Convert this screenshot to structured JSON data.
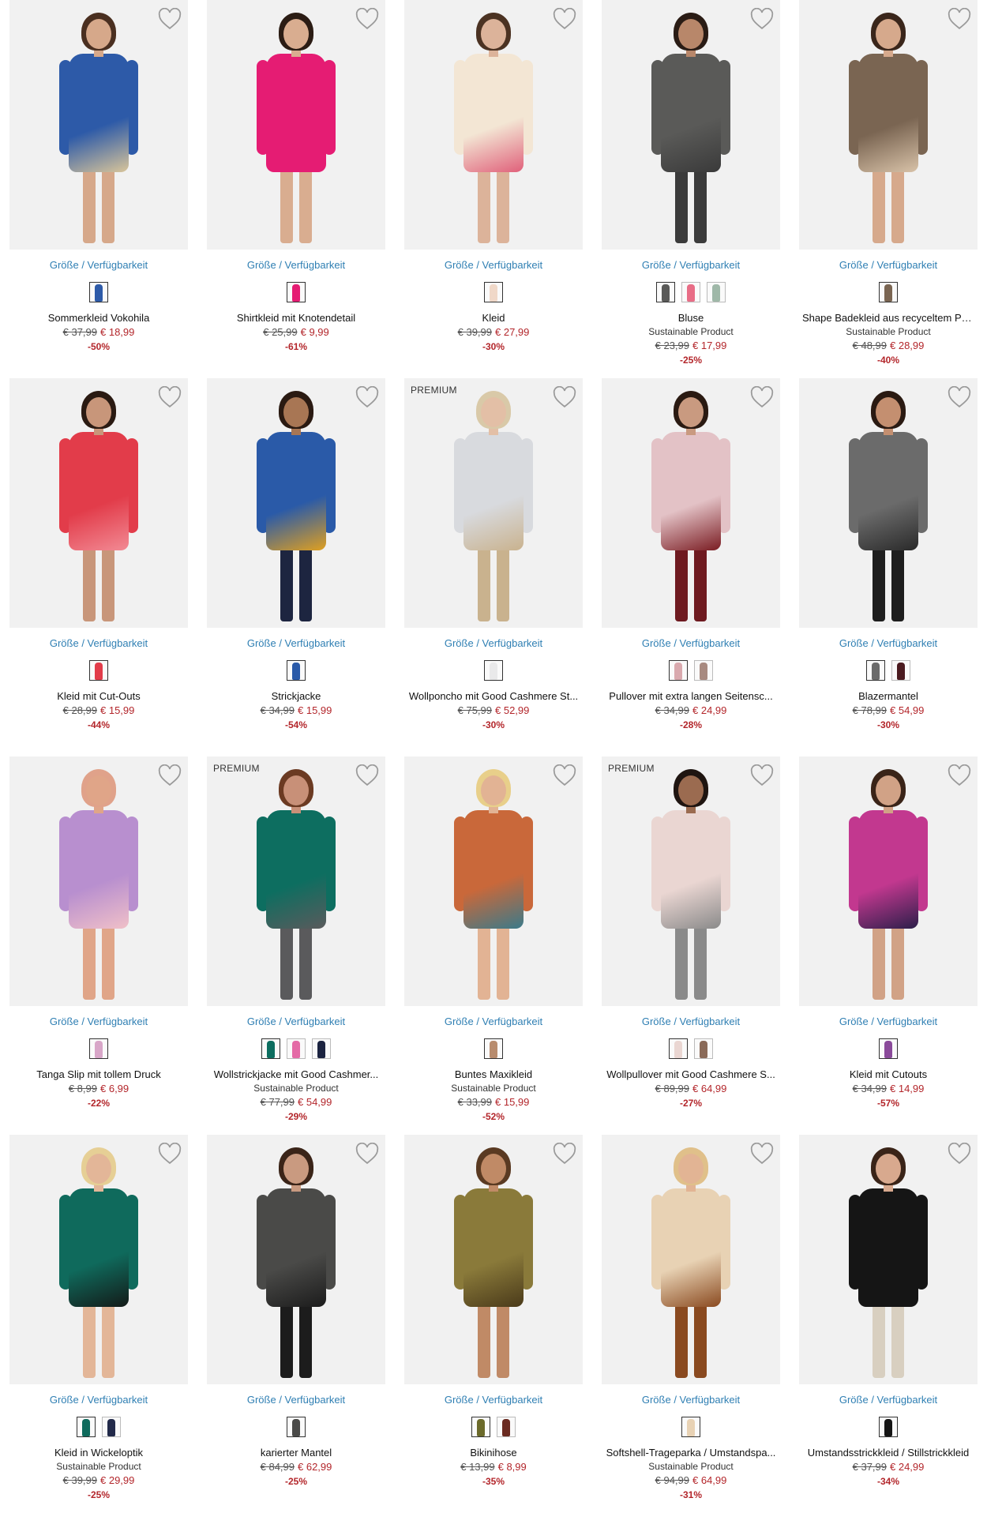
{
  "availability_label": "Größe / Verfügbarkeit",
  "products": [
    {
      "badge": "",
      "name": "Sommerkleid Vokohila",
      "sub": "",
      "old_price": "€ 37,99",
      "price": "€ 18,99",
      "discount": "-50%",
      "garment": "#2d5aa8",
      "garment2": "#d9c59a",
      "hair": "#4a2f20",
      "skin": "#d6a88a",
      "legs": "skin",
      "swatches": [
        "#2d5aa8"
      ]
    },
    {
      "badge": "",
      "name": "Shirtkleid mit Knotendetail",
      "sub": "",
      "old_price": "€ 25,99",
      "price": "€ 9,99",
      "discount": "-61%",
      "garment": "#e51c73",
      "garment2": "#e51c73",
      "hair": "#2b1c14",
      "skin": "#d9ad90",
      "legs": "skin",
      "swatches": [
        "#e51c73"
      ]
    },
    {
      "badge": "",
      "name": "Kleid",
      "sub": "",
      "old_price": "€ 39,99",
      "price": "€ 27,99",
      "discount": "-30%",
      "garment": "#f3e6d4",
      "garment2": "#e0607a",
      "hair": "#4b3222",
      "skin": "#dcb39a",
      "legs": "skin",
      "swatches": [
        "#f0d8c8"
      ]
    },
    {
      "badge": "",
      "name": "Bluse",
      "sub": "Sustainable Product",
      "old_price": "€ 23,99",
      "price": "€ 17,99",
      "discount": "-25%",
      "garment": "#5a5a58",
      "garment2": "#3a3a3a",
      "hair": "#2a1c15",
      "skin": "#b8876a",
      "legs": "#3b3b3b",
      "swatches": [
        "#5a5a58",
        "#e86d86",
        "#9fb8a8"
      ]
    },
    {
      "badge": "",
      "name": "Shape Badekleid aus recyceltem Po...",
      "sub": "Sustainable Product",
      "old_price": "€ 48,99",
      "price": "€ 28,99",
      "discount": "-40%",
      "garment": "#7a6552",
      "garment2": "#d8c2a8",
      "hair": "#3a261b",
      "skin": "#d6a98c",
      "legs": "skin",
      "swatches": [
        "#7a6552"
      ]
    },
    {
      "badge": "",
      "name": "Kleid mit Cut-Outs",
      "sub": "",
      "old_price": "€ 28,99",
      "price": "€ 15,99",
      "discount": "-44%",
      "garment": "#e23c4a",
      "garment2": "#f28a94",
      "hair": "#2a1a12",
      "skin": "#c8967a",
      "legs": "skin",
      "swatches": [
        "#e23c4a"
      ]
    },
    {
      "badge": "",
      "name": "Strickjacke",
      "sub": "",
      "old_price": "€ 34,99",
      "price": "€ 15,99",
      "discount": "-54%",
      "garment": "#2a5aa8",
      "garment2": "#e0a020",
      "hair": "#2a1a12",
      "skin": "#a87654",
      "legs": "#1d2540",
      "swatches": [
        "#2a5aa8"
      ]
    },
    {
      "badge": "PREMIUM",
      "name": "Wollponcho mit Good Cashmere St...",
      "sub": "",
      "old_price": "€ 75,99",
      "price": "€ 52,99",
      "discount": "-30%",
      "garment": "#d8dade",
      "garment2": "#c9b28e",
      "hair": "#d9c9a8",
      "skin": "#e3bfa6",
      "legs": "#c9b28e",
      "swatches": [
        "#e9e9ea"
      ]
    },
    {
      "badge": "",
      "name": "Pullover mit extra langen Seitensc...",
      "sub": "",
      "old_price": "€ 34,99",
      "price": "€ 24,99",
      "discount": "-28%",
      "garment": "#e3c2c6",
      "garment2": "#7a1c22",
      "hair": "#2a1a12",
      "skin": "#c99a80",
      "legs": "#6e1a20",
      "swatches": [
        "#d9a9ae",
        "#a88a80"
      ]
    },
    {
      "badge": "",
      "name": "Blazermantel",
      "sub": "",
      "old_price": "€ 78,99",
      "price": "€ 54,99",
      "discount": "-30%",
      "garment": "#6b6b6b",
      "garment2": "#2a2a2a",
      "hair": "#2a1a12",
      "skin": "#c48f70",
      "legs": "#1e1e1e",
      "swatches": [
        "#6b6b6b",
        "#4a1a1f"
      ]
    },
    {
      "badge": "",
      "name": "Tanga Slip mit tollem Druck",
      "sub": "",
      "old_price": "€ 8,99",
      "price": "€ 6,99",
      "discount": "-22%",
      "garment": "#b88fcf",
      "garment2": "#f0c0c8",
      "hair": "#e0a28a",
      "skin": "#e0a588",
      "legs": "skin",
      "swatches": [
        "#d8a6c8"
      ]
    },
    {
      "badge": "PREMIUM",
      "name": "Wollstrickjacke mit Good Cashmer...",
      "sub": "Sustainable Product",
      "old_price": "€ 77,99",
      "price": "€ 54,99",
      "discount": "-29%",
      "garment": "#0d6e60",
      "garment2": "#5a5a5c",
      "hair": "#6b3a22",
      "skin": "#c89078",
      "legs": "#5a5a5c",
      "swatches": [
        "#0d6e60",
        "#e46aa6",
        "#1b2340"
      ]
    },
    {
      "badge": "",
      "name": "Buntes Maxikleid",
      "sub": "Sustainable Product",
      "old_price": "€ 33,99",
      "price": "€ 15,99",
      "discount": "-52%",
      "garment": "#c9683a",
      "garment2": "#3a7a8a",
      "hair": "#e8cf8a",
      "skin": "#e2b394",
      "legs": "skin",
      "swatches": [
        "#b88c6e"
      ]
    },
    {
      "badge": "PREMIUM",
      "name": "Wollpullover mit Good Cashmere S...",
      "sub": "",
      "old_price": "€ 89,99",
      "price": "€ 64,99",
      "discount": "-27%",
      "garment": "#ead6d2",
      "garment2": "#8a8a8a",
      "hair": "#1f1511",
      "skin": "#9b6b50",
      "legs": "#8a8a8a",
      "swatches": [
        "#ead6d2",
        "#8a6a58"
      ]
    },
    {
      "badge": "",
      "name": "Kleid mit Cutouts",
      "sub": "",
      "old_price": "€ 34,99",
      "price": "€ 14,99",
      "discount": "-57%",
      "garment": "#c2388f",
      "garment2": "#2c1f4a",
      "hair": "#3a2418",
      "skin": "#d1a286",
      "legs": "skin",
      "swatches": [
        "#8a4a9a"
      ]
    },
    {
      "badge": "",
      "name": "Kleid in Wickeloptik",
      "sub": "Sustainable Product",
      "old_price": "€ 39,99",
      "price": "€ 29,99",
      "discount": "-25%",
      "garment": "#0f6a5c",
      "garment2": "#141a18",
      "hair": "#e6cf95",
      "skin": "#e3b698",
      "legs": "skin",
      "swatches": [
        "#0f6a5c",
        "#222a4a"
      ]
    },
    {
      "badge": "",
      "name": "karierter Mantel",
      "sub": "",
      "old_price": "€ 84,99",
      "price": "€ 62,99",
      "discount": "-25%",
      "garment": "#4a4a48",
      "garment2": "#1c1c1c",
      "hair": "#3a2418",
      "skin": "#c99a80",
      "legs": "#1c1c1c",
      "swatches": [
        "#4a4a48"
      ]
    },
    {
      "badge": "",
      "name": "Bikinihose",
      "sub": "",
      "old_price": "€ 13,99",
      "price": "€ 8,99",
      "discount": "-35%",
      "garment": "#8a7a3a",
      "garment2": "#4a3a1a",
      "hair": "#5a3a22",
      "skin": "#c08a66",
      "legs": "skin",
      "swatches": [
        "#6b6a2a",
        "#6a2a20"
      ]
    },
    {
      "badge": "",
      "name": "Softshell-Trageparka / Umstandspa...",
      "sub": "Sustainable Product",
      "old_price": "€ 94,99",
      "price": "€ 64,99",
      "discount": "-31%",
      "garment": "#e8d2b4",
      "garment2": "#8a4a20",
      "hair": "#e0c08a",
      "skin": "#e2b494",
      "legs": "#8a4a20",
      "swatches": [
        "#e8d2b4"
      ]
    },
    {
      "badge": "",
      "name": "Umstandsstrickkleid / Stillstrickkleid",
      "sub": "",
      "old_price": "€ 37,99",
      "price": "€ 24,99",
      "discount": "-34%",
      "garment": "#151515",
      "garment2": "#151515",
      "hair": "#3a2418",
      "skin": "#d8a98e",
      "legs": "#d8cfc0",
      "swatches": [
        "#151515"
      ]
    }
  ]
}
